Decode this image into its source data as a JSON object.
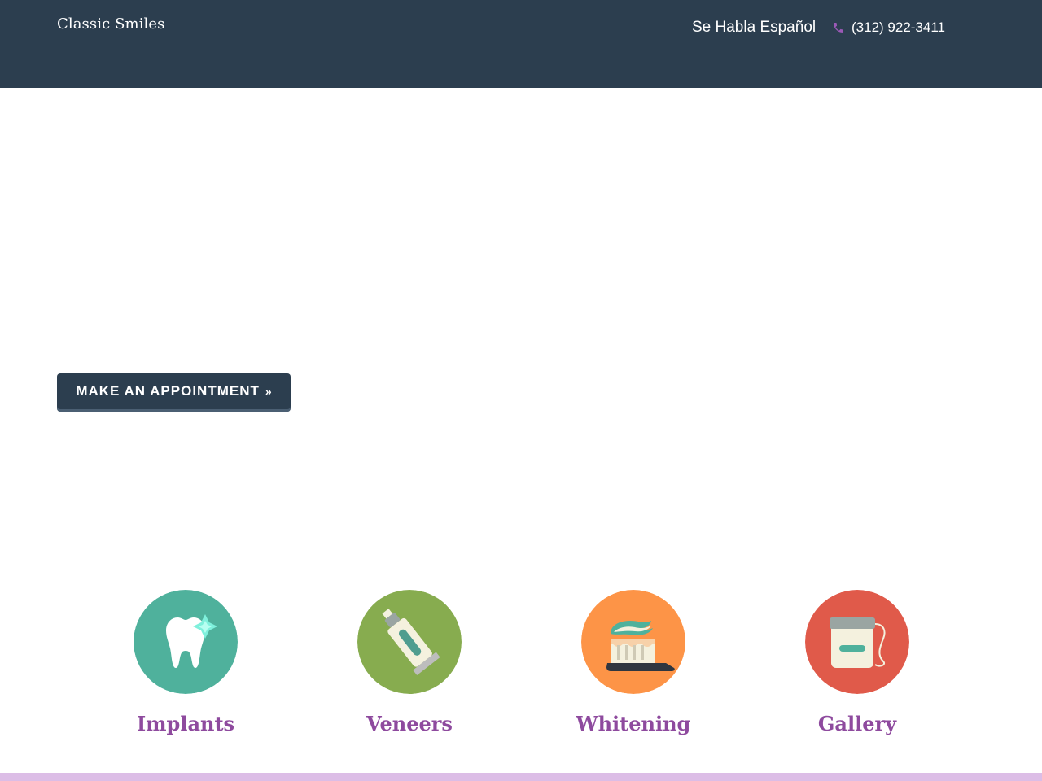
{
  "header": {
    "brand": "Classic Smiles",
    "language_link": "Se Habla Español",
    "phone": "(312) 922-3411",
    "phone_icon": "phone-icon",
    "background": "#2c3e4f",
    "accent": "#9b59b6"
  },
  "hero": {
    "cta_label": "Make an Appointment",
    "cta_icon": "double-chevron-right-icon"
  },
  "services": [
    {
      "label": "Implants",
      "icon": "sparkling-tooth-icon",
      "color": "#4fb19c"
    },
    {
      "label": "Veneers",
      "icon": "toothpaste-tube-icon",
      "color": "#87ac4f"
    },
    {
      "label": "Whitening",
      "icon": "toothbrush-icon",
      "color": "#fd9447"
    },
    {
      "label": "Gallery",
      "icon": "dental-floss-icon",
      "color": "#e05a4a"
    }
  ],
  "colors": {
    "service_label": "#8e4a9e",
    "footer_strip": "#dcbde6"
  }
}
